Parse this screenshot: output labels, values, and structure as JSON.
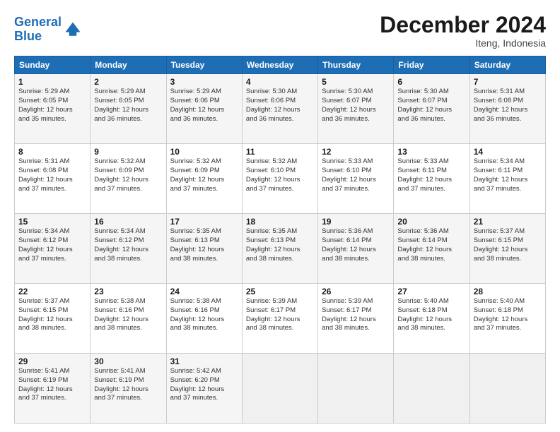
{
  "header": {
    "logo_line1": "General",
    "logo_line2": "Blue",
    "title": "December 2024",
    "subtitle": "Iteng, Indonesia"
  },
  "weekdays": [
    "Sunday",
    "Monday",
    "Tuesday",
    "Wednesday",
    "Thursday",
    "Friday",
    "Saturday"
  ],
  "weeks": [
    [
      {
        "day": "1",
        "info": "Sunrise: 5:29 AM\nSunset: 6:05 PM\nDaylight: 12 hours\nand 35 minutes."
      },
      {
        "day": "2",
        "info": "Sunrise: 5:29 AM\nSunset: 6:05 PM\nDaylight: 12 hours\nand 36 minutes."
      },
      {
        "day": "3",
        "info": "Sunrise: 5:29 AM\nSunset: 6:06 PM\nDaylight: 12 hours\nand 36 minutes."
      },
      {
        "day": "4",
        "info": "Sunrise: 5:30 AM\nSunset: 6:06 PM\nDaylight: 12 hours\nand 36 minutes."
      },
      {
        "day": "5",
        "info": "Sunrise: 5:30 AM\nSunset: 6:07 PM\nDaylight: 12 hours\nand 36 minutes."
      },
      {
        "day": "6",
        "info": "Sunrise: 5:30 AM\nSunset: 6:07 PM\nDaylight: 12 hours\nand 36 minutes."
      },
      {
        "day": "7",
        "info": "Sunrise: 5:31 AM\nSunset: 6:08 PM\nDaylight: 12 hours\nand 36 minutes."
      }
    ],
    [
      {
        "day": "8",
        "info": "Sunrise: 5:31 AM\nSunset: 6:08 PM\nDaylight: 12 hours\nand 37 minutes."
      },
      {
        "day": "9",
        "info": "Sunrise: 5:32 AM\nSunset: 6:09 PM\nDaylight: 12 hours\nand 37 minutes."
      },
      {
        "day": "10",
        "info": "Sunrise: 5:32 AM\nSunset: 6:09 PM\nDaylight: 12 hours\nand 37 minutes."
      },
      {
        "day": "11",
        "info": "Sunrise: 5:32 AM\nSunset: 6:10 PM\nDaylight: 12 hours\nand 37 minutes."
      },
      {
        "day": "12",
        "info": "Sunrise: 5:33 AM\nSunset: 6:10 PM\nDaylight: 12 hours\nand 37 minutes."
      },
      {
        "day": "13",
        "info": "Sunrise: 5:33 AM\nSunset: 6:11 PM\nDaylight: 12 hours\nand 37 minutes."
      },
      {
        "day": "14",
        "info": "Sunrise: 5:34 AM\nSunset: 6:11 PM\nDaylight: 12 hours\nand 37 minutes."
      }
    ],
    [
      {
        "day": "15",
        "info": "Sunrise: 5:34 AM\nSunset: 6:12 PM\nDaylight: 12 hours\nand 37 minutes."
      },
      {
        "day": "16",
        "info": "Sunrise: 5:34 AM\nSunset: 6:12 PM\nDaylight: 12 hours\nand 38 minutes."
      },
      {
        "day": "17",
        "info": "Sunrise: 5:35 AM\nSunset: 6:13 PM\nDaylight: 12 hours\nand 38 minutes."
      },
      {
        "day": "18",
        "info": "Sunrise: 5:35 AM\nSunset: 6:13 PM\nDaylight: 12 hours\nand 38 minutes."
      },
      {
        "day": "19",
        "info": "Sunrise: 5:36 AM\nSunset: 6:14 PM\nDaylight: 12 hours\nand 38 minutes."
      },
      {
        "day": "20",
        "info": "Sunrise: 5:36 AM\nSunset: 6:14 PM\nDaylight: 12 hours\nand 38 minutes."
      },
      {
        "day": "21",
        "info": "Sunrise: 5:37 AM\nSunset: 6:15 PM\nDaylight: 12 hours\nand 38 minutes."
      }
    ],
    [
      {
        "day": "22",
        "info": "Sunrise: 5:37 AM\nSunset: 6:15 PM\nDaylight: 12 hours\nand 38 minutes."
      },
      {
        "day": "23",
        "info": "Sunrise: 5:38 AM\nSunset: 6:16 PM\nDaylight: 12 hours\nand 38 minutes."
      },
      {
        "day": "24",
        "info": "Sunrise: 5:38 AM\nSunset: 6:16 PM\nDaylight: 12 hours\nand 38 minutes."
      },
      {
        "day": "25",
        "info": "Sunrise: 5:39 AM\nSunset: 6:17 PM\nDaylight: 12 hours\nand 38 minutes."
      },
      {
        "day": "26",
        "info": "Sunrise: 5:39 AM\nSunset: 6:17 PM\nDaylight: 12 hours\nand 38 minutes."
      },
      {
        "day": "27",
        "info": "Sunrise: 5:40 AM\nSunset: 6:18 PM\nDaylight: 12 hours\nand 38 minutes."
      },
      {
        "day": "28",
        "info": "Sunrise: 5:40 AM\nSunset: 6:18 PM\nDaylight: 12 hours\nand 37 minutes."
      }
    ],
    [
      {
        "day": "29",
        "info": "Sunrise: 5:41 AM\nSunset: 6:19 PM\nDaylight: 12 hours\nand 37 minutes."
      },
      {
        "day": "30",
        "info": "Sunrise: 5:41 AM\nSunset: 6:19 PM\nDaylight: 12 hours\nand 37 minutes."
      },
      {
        "day": "31",
        "info": "Sunrise: 5:42 AM\nSunset: 6:20 PM\nDaylight: 12 hours\nand 37 minutes."
      },
      {
        "day": "",
        "info": ""
      },
      {
        "day": "",
        "info": ""
      },
      {
        "day": "",
        "info": ""
      },
      {
        "day": "",
        "info": ""
      }
    ]
  ]
}
